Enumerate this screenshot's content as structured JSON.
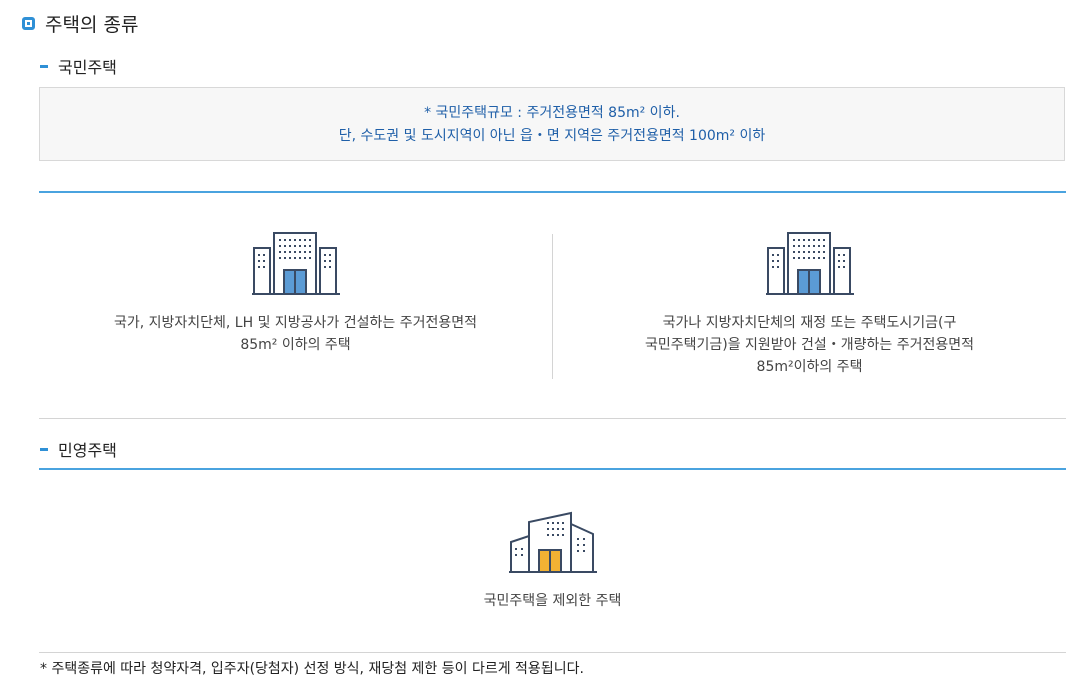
{
  "main_title": "주택의 종류",
  "national": {
    "title": "국민주택",
    "notice_line1": "* 국민주택규모 : 주거전용면적 85m² 이하.",
    "notice_line2": "단, 수도권 및 도시지역이 아닌 읍・면 지역은 주거전용면적 100m² 이하",
    "items": [
      {
        "icon": "building-icon",
        "desc_line1": "국가, 지방자치단체, LH 및 지방공사가 건설하는 주거전용면적",
        "desc_line2": "85m² 이하의 주택"
      },
      {
        "icon": "building-icon",
        "desc_line1": "국가나 지방자치단체의 재정 또는 주택도시기금(구",
        "desc_line2": "국민주택기금)을 지원받아 건설・개량하는 주거전용면적",
        "desc_line3": "85m²이하의 주택"
      }
    ]
  },
  "private": {
    "title": "민영주택",
    "icon": "building-icon",
    "desc": "국민주택을 제외한 주택"
  },
  "footnote": "* 주택종류에 따라 청약자격, 입주자(당첨자) 선정 방식, 재당첨 제한 등이 다르게 적용됩니다.",
  "colors": {
    "accent": "#2f90d6",
    "notice_text": "#1f5fa8",
    "building_stroke": "#3a4a63",
    "door_blue": "#5b9bd5",
    "door_yellow": "#f2b233"
  }
}
